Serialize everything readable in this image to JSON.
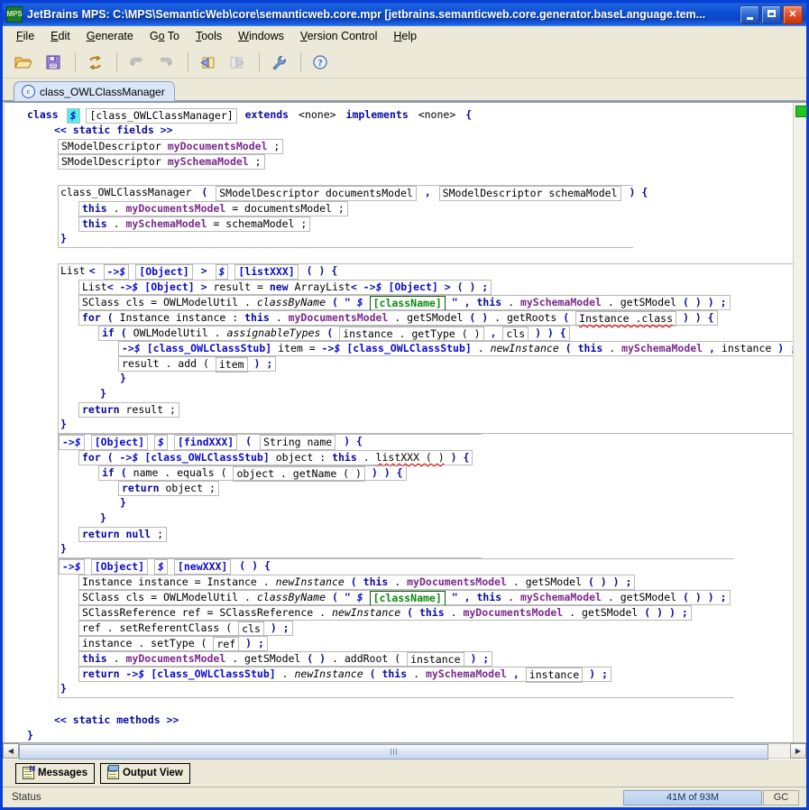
{
  "window": {
    "title": "JetBrains MPS: C:\\MPS\\SemanticWeb\\core\\semanticweb.core.mpr  [jetbrains.semanticweb.core.generator.baseLanguage.tem...",
    "app_icon_text": "MPS",
    "minimize_label": "Minimize",
    "maximize_label": "Maximize",
    "close_label": "✕"
  },
  "menu": {
    "items": [
      {
        "pre": "",
        "mn": "F",
        "post": "ile"
      },
      {
        "pre": "",
        "mn": "E",
        "post": "dit"
      },
      {
        "pre": "",
        "mn": "G",
        "post": "enerate"
      },
      {
        "pre": "G",
        "mn": "o",
        "post": " To"
      },
      {
        "pre": "",
        "mn": "T",
        "post": "ools"
      },
      {
        "pre": "",
        "mn": "W",
        "post": "indows"
      },
      {
        "pre": "",
        "mn": "V",
        "post": "ersion Control"
      },
      {
        "pre": "",
        "mn": "H",
        "post": "elp"
      }
    ]
  },
  "toolbar": {
    "buttons": [
      {
        "name": "open-project-icon",
        "title": "Open Project"
      },
      {
        "name": "save-all-icon",
        "title": "Save All"
      },
      {
        "name": "generate-icon",
        "title": "Generate"
      },
      {
        "name": "undo-icon",
        "title": "Undo"
      },
      {
        "name": "redo-icon",
        "title": "Redo"
      },
      {
        "name": "back-icon",
        "title": "Back"
      },
      {
        "name": "forward-icon",
        "title": "Forward"
      },
      {
        "name": "settings-icon",
        "title": "Settings"
      },
      {
        "name": "help-icon",
        "title": "Help"
      }
    ]
  },
  "tabs": [
    {
      "label": "class_OWLClassManager",
      "icon": "c",
      "active": true
    }
  ],
  "editor": {
    "stripe_marker_color": "#22c522",
    "code": {
      "class_keyword": "class",
      "dollar": "$",
      "class_name_ref": "[class_OWLClassManager]",
      "extends_kw": "extends",
      "extends_val": "<none>",
      "implements_kw": "implements",
      "implements_val": "<none>",
      "open_brace": "{",
      "static_fields_label": "<< static fields >>",
      "static_methods_label": "<< static methods >>",
      "field1_type": "SModelDescriptor",
      "field1_name": "myDocumentsModel",
      "field2_type": "SModelDescriptor",
      "field2_name": "mySchemaModel",
      "ctor_name": "class_OWLClassManager",
      "ctor_param1": "SModelDescriptor documentsModel",
      "ctor_param2": "SModelDescriptor schemaModel",
      "ctor_body1_this": "this",
      "ctor_body1_field": "myDocumentsModel",
      "ctor_body1_rhs": "documentsModel",
      "ctor_body2_this": "this",
      "ctor_body2_field": "mySchemaModel",
      "ctor_body2_rhs": "schemaModel",
      "list_kw": "List",
      "arrow_dollar": "->$",
      "object_ref": "[Object]",
      "listxxx_name": "[listXXX]",
      "result_decl_new": "new",
      "arraylist": "ArrayList",
      "sclass_decl": "SClass cls = OWLModelUtil .",
      "class_by_name": "classByName",
      "class_name_tpl": "[className]",
      "this_kw": "this",
      "my_schema_model": "mySchemaModel",
      "get_smodel": "getSModel",
      "for_kw": "for",
      "for_instance_decl": "Instance instance :",
      "my_documents_model": "myDocumentsModel",
      "get_roots": "getRoots",
      "instance_class": "Instance .class",
      "if_kw": "if",
      "owl_model_util": "OWLModelUtil .",
      "assignable_types": "assignableTypes",
      "instance_get_type": "instance . getType (  )",
      "cls_arg": "cls",
      "stub_ref": "[class_OWLClassStub]",
      "item_eq": "item =",
      "new_instance": "newInstance",
      "instance_arg": "instance",
      "result_add": "result . add (",
      "item_arg": "item",
      "return_kw": "return",
      "return_result": "result",
      "findxxx_name": "[findXXX]",
      "findxxx_param": "String name",
      "for_object_decl": "object :",
      "listxxx_call": "listXXX (  )",
      "if_name_equals": "name . equals (",
      "object_get_name": "object . getName (  )",
      "return_object": "object",
      "return_null": "null",
      "newxxx_name": "[newXXX]",
      "instance_decl": "Instance instance = Instance .",
      "sclassref_decl": "SClassReference ref = SClassReference .",
      "set_referent_class": "ref . setReferentClass (",
      "set_type": "instance . setType (",
      "ref_arg": "ref",
      "add_root": "addRoot (",
      "close_brace": "}"
    }
  },
  "scrollbar": {
    "left_arrow": "◀",
    "right_arrow": "▶"
  },
  "toolwindows": [
    {
      "label": "Messages",
      "icon": "messages-icon"
    },
    {
      "label": "Output View",
      "icon": "output-view-icon"
    }
  ],
  "status": {
    "text": "Status",
    "memory": "41M of 93M",
    "gc_label": "GC"
  }
}
